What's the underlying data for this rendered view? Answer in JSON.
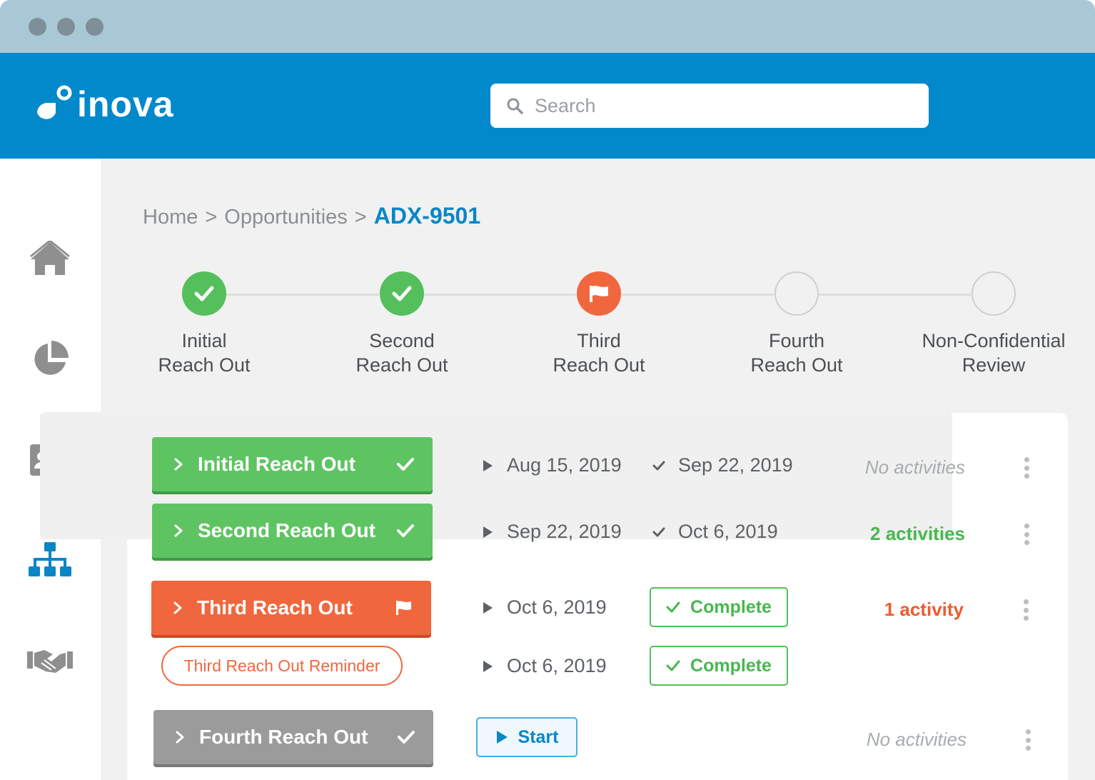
{
  "colors": {
    "header": "#0289cb",
    "done": "#55bf5c",
    "active": "#f0673e",
    "inactive": "#9b9b9b",
    "link": "#0a86c7"
  },
  "app": {
    "logo_text": "inova"
  },
  "search": {
    "placeholder": "Search"
  },
  "sidebar": {
    "items": [
      {
        "icon": "home-icon"
      },
      {
        "icon": "pie-chart-icon"
      },
      {
        "icon": "contact-card-icon"
      },
      {
        "icon": "org-chart-icon",
        "active": true
      },
      {
        "icon": "handshake-icon"
      }
    ]
  },
  "breadcrumb": {
    "home": "Home",
    "sep": ">",
    "opportunities": "Opportunities",
    "current": "ADX-9501"
  },
  "steps": [
    {
      "line1": "Initial",
      "line2": "Reach Out",
      "status": "done"
    },
    {
      "line1": "Second",
      "line2": "Reach Out",
      "status": "done"
    },
    {
      "line1": "Third",
      "line2": "Reach Out",
      "status": "active"
    },
    {
      "line1": "Fourth",
      "line2": "Reach Out",
      "status": "todo"
    },
    {
      "line1": "Non-Confidential",
      "line2": "Review",
      "status": "todo"
    }
  ],
  "rows": {
    "r1": {
      "label": "Initial Reach Out",
      "start": "Aug 15, 2019",
      "end": "Sep 22, 2019",
      "activity": "No activities"
    },
    "r2": {
      "label": "Second Reach Out",
      "start": "Sep 22, 2019",
      "end": "Oct 6, 2019",
      "activity": "2 activities"
    },
    "r3": {
      "label": "Third Reach Out",
      "start": "Oct 6, 2019",
      "status": "Complete",
      "activity": "1 activity"
    },
    "r3b": {
      "label": "Third Reach Out Reminder",
      "start": "Oct 6, 2019",
      "status": "Complete"
    },
    "r4": {
      "label": "Fourth Reach Out",
      "action": "Start",
      "activity": "No activities"
    }
  }
}
